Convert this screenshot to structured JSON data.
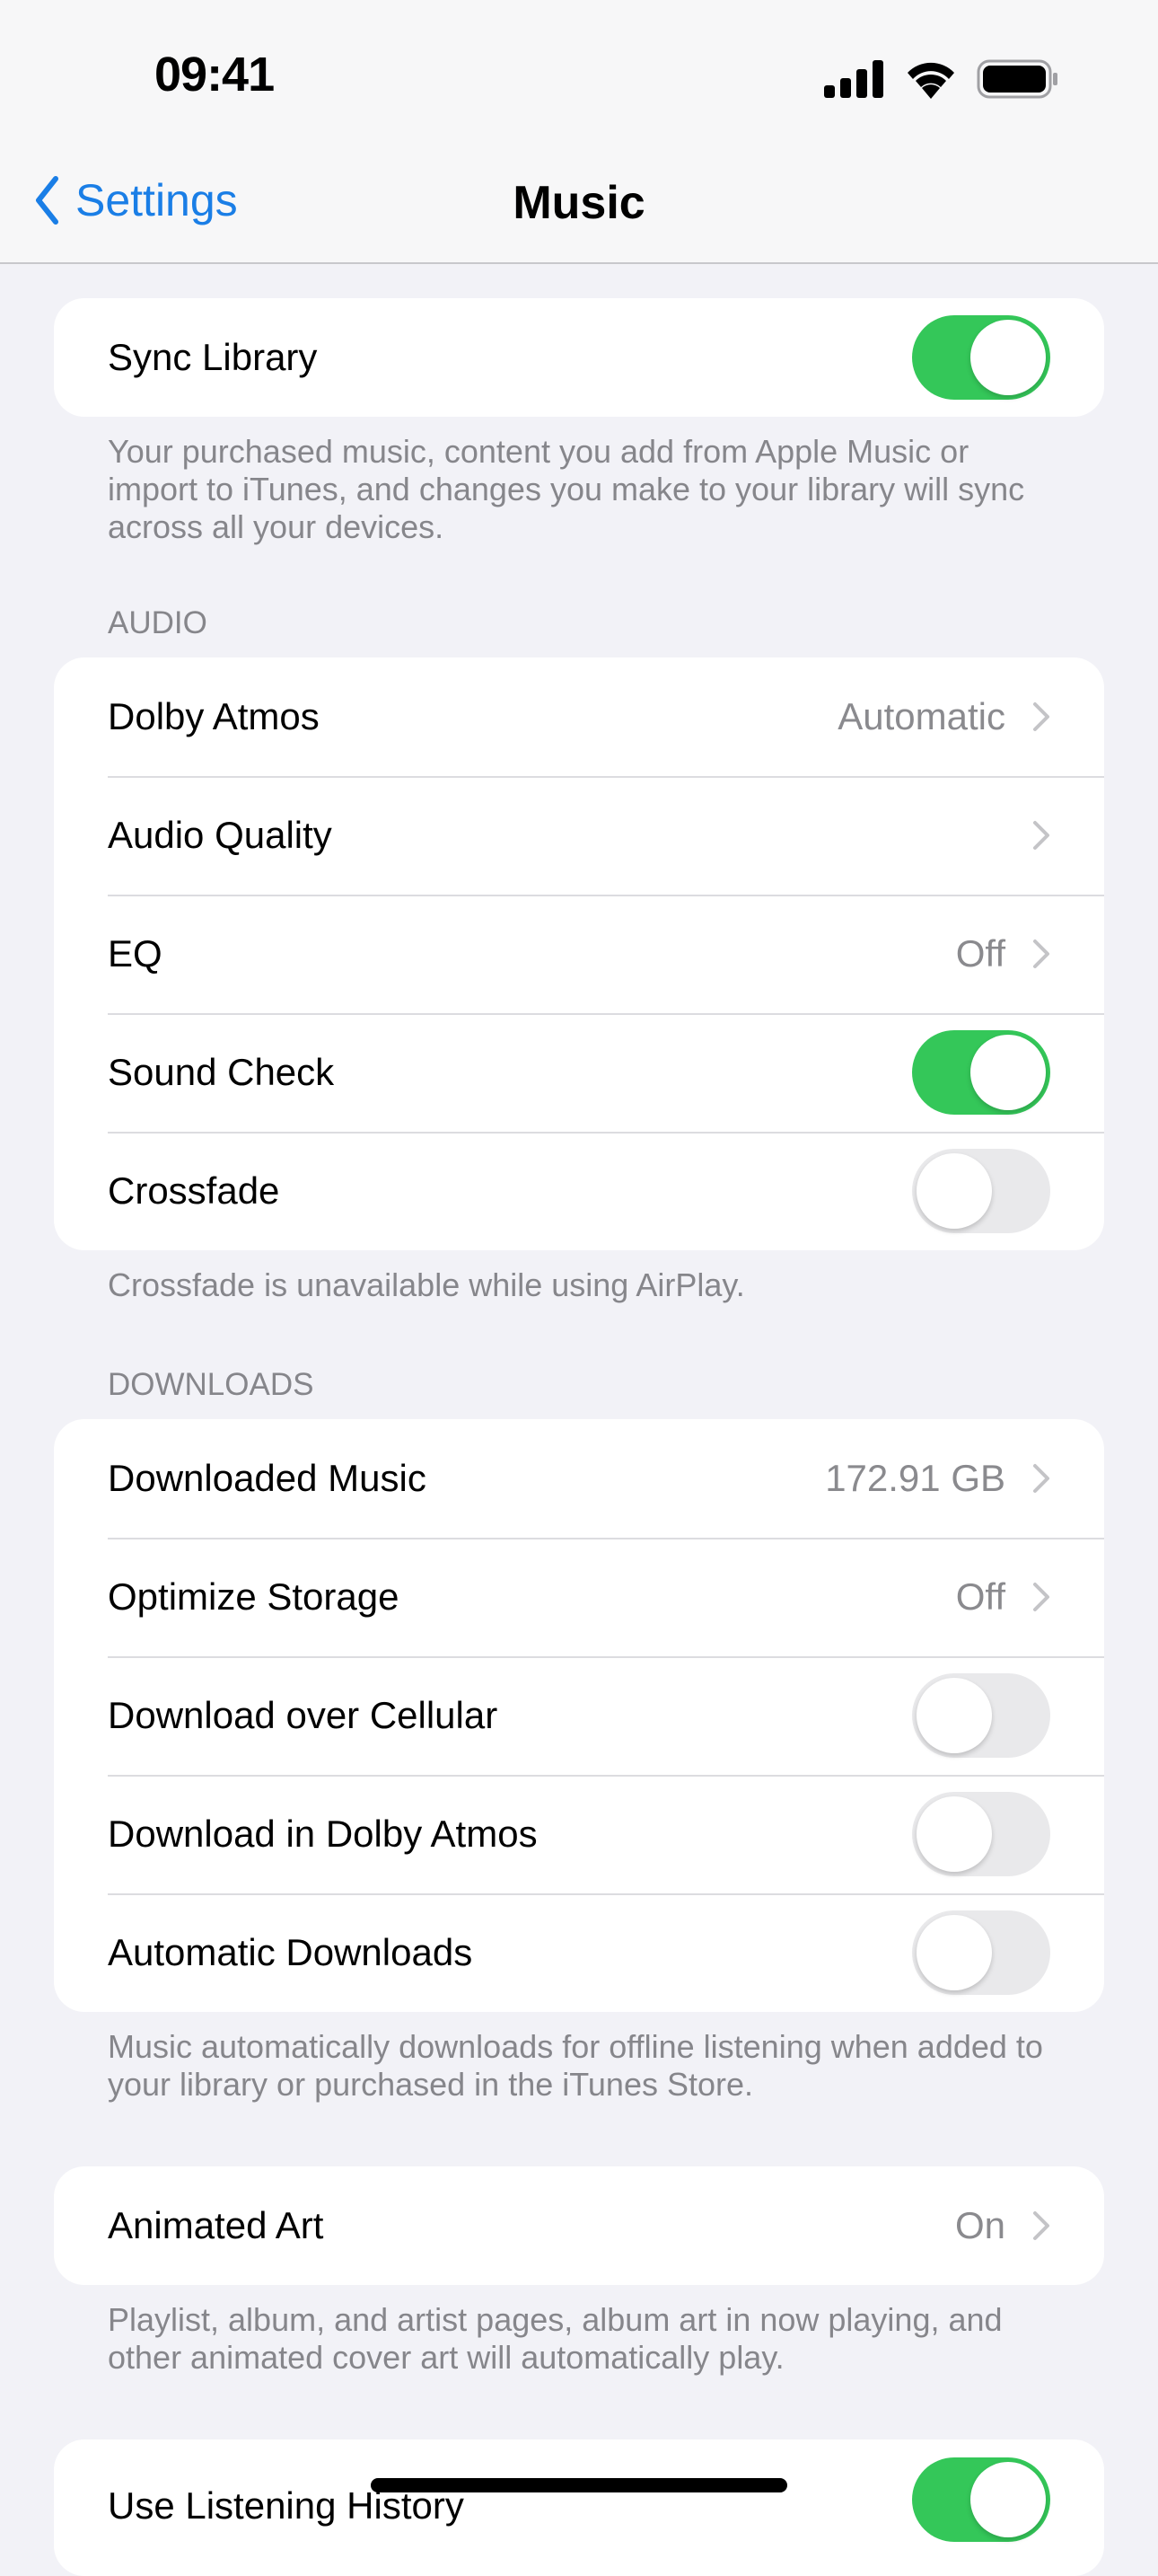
{
  "status_bar": {
    "time": "09:41"
  },
  "nav": {
    "back_label": "Settings",
    "title": "Music"
  },
  "sync": {
    "label": "Sync Library",
    "on": true,
    "footer": "Your purchased music, content you add from Apple Music or import to iTunes, and changes you make to your library will sync across all your devices."
  },
  "audio": {
    "header": "AUDIO",
    "rows": [
      {
        "label": "Dolby Atmos",
        "value": "Automatic"
      },
      {
        "label": "Audio Quality",
        "value": ""
      },
      {
        "label": "EQ",
        "value": "Off"
      },
      {
        "label": "Sound Check",
        "toggle": true
      },
      {
        "label": "Crossfade",
        "toggle": false
      }
    ],
    "footer": "Crossfade is unavailable while using AirPlay."
  },
  "downloads": {
    "header": "DOWNLOADS",
    "rows": [
      {
        "label": "Downloaded Music",
        "value": "172.91 GB"
      },
      {
        "label": "Optimize Storage",
        "value": "Off"
      },
      {
        "label": "Download over Cellular",
        "toggle": false
      },
      {
        "label": "Download in Dolby Atmos",
        "toggle": false
      },
      {
        "label": "Automatic Downloads",
        "toggle": false
      }
    ],
    "footer": "Music automatically downloads for offline listening when added to your library or purchased in the iTunes Store."
  },
  "animated_art": {
    "label": "Animated Art",
    "value": "On",
    "footer": "Playlist, album, and artist pages, album art in now playing, and other animated cover art will automatically play."
  },
  "listening_history": {
    "label": "Use Listening History",
    "on": true
  },
  "colors": {
    "accent": "#1a7ee6",
    "toggle_on": "#34c759",
    "toggle_off": "#e9e9eb",
    "secondary_text": "#86868b",
    "background": "#f2f2f7"
  }
}
